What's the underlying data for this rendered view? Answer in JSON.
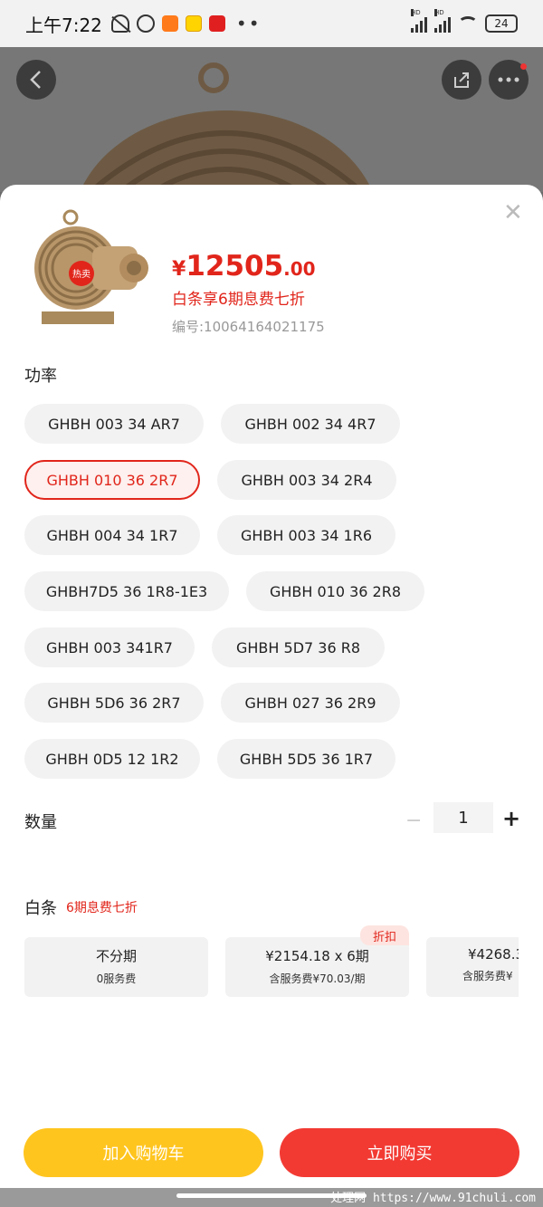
{
  "status_bar": {
    "time": "上午7:22",
    "battery": "24",
    "hd_label": "HD"
  },
  "product": {
    "price_currency": "¥",
    "price_integer": "12505",
    "price_decimal": ".00",
    "promo": "白条享6期息费七折",
    "sku": "编号:10064164021175",
    "badge": "热卖"
  },
  "power": {
    "label": "功率",
    "selected": "GHBH 010 36 2R7",
    "options": [
      "GHBH 003 34 AR7",
      "GHBH 002 34 4R7",
      "GHBH 010 36 2R7",
      "GHBH 003 34 2R4",
      "GHBH 004 34 1R7",
      "GHBH 003 34 1R6",
      "GHBH7D5 36 1R8-1E3",
      "GHBH 010 36 2R8",
      "GHBH 003 341R7",
      "GHBH 5D7 36 R8",
      "GHBH 5D6 36 2R7",
      "GHBH 027 36 2R9",
      "GHBH 0D5 12 1R2",
      "GHBH 5D5 36 1R7"
    ]
  },
  "quantity": {
    "label": "数量",
    "value": "1",
    "minus": "−",
    "plus": "+"
  },
  "baitiao": {
    "label": "白条",
    "sub": "6期息费七折",
    "discount_tag": "折扣",
    "plans": [
      {
        "line1": "不分期",
        "line2": "0服务费"
      },
      {
        "line1": "¥2154.18 x 6期",
        "line2": "含服务费¥70.03/期"
      },
      {
        "line1": "¥4268.3",
        "line2": "含服务费¥"
      }
    ]
  },
  "actions": {
    "add_to_cart": "加入购物车",
    "buy_now": "立即购买"
  },
  "watermark": "处理网 https://www.91chuli.com",
  "colors": {
    "accent_red": "#e1251b",
    "cart_yellow": "#ffc51f",
    "buy_red": "#f23a33"
  }
}
